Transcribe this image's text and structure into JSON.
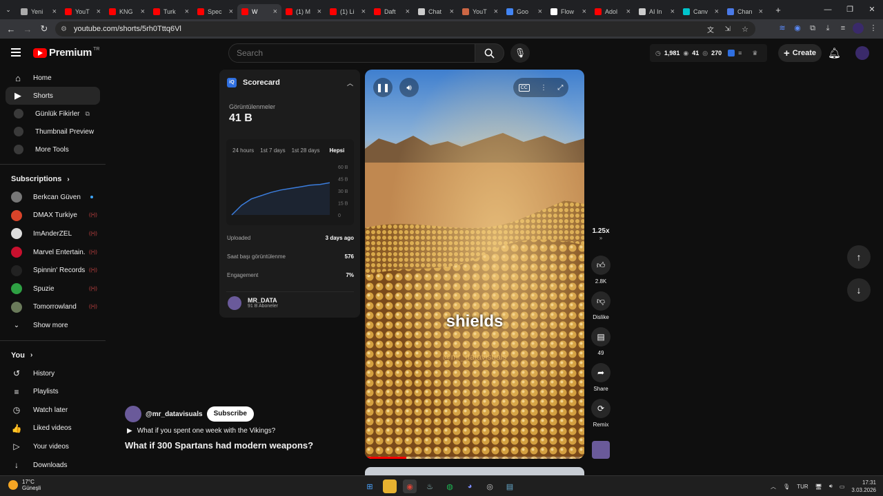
{
  "browser": {
    "tabs": [
      {
        "label": "Yeni",
        "color": "#aaaaaa"
      },
      {
        "label": "YouT",
        "color": "#ff0000"
      },
      {
        "label": "KNG",
        "color": "#ff0000"
      },
      {
        "label": "Turk",
        "color": "#ff0000"
      },
      {
        "label": "Spec",
        "color": "#ff0000"
      },
      {
        "label": "W",
        "color": "#ff0000",
        "active": true
      },
      {
        "label": "(1) M",
        "color": "#ff0000"
      },
      {
        "label": "(1) Li",
        "color": "#ff0000"
      },
      {
        "label": "Daft",
        "color": "#ff0000"
      },
      {
        "label": "Chat",
        "color": "#cccccc"
      },
      {
        "label": "YouT",
        "color": "#cc6644"
      },
      {
        "label": "Goo",
        "color": "#4285f4"
      },
      {
        "label": "Flow",
        "color": "#ffffff"
      },
      {
        "label": "Adol",
        "color": "#ff0000"
      },
      {
        "label": "AI In",
        "color": "#cccccc"
      },
      {
        "label": "Canv",
        "color": "#00c4cc"
      },
      {
        "label": "Chan",
        "color": "#4a7ae8"
      }
    ],
    "url": "youtube.com/shorts/5rh0Tttq6Vl"
  },
  "header": {
    "logo_text": "Premium",
    "country": "TR",
    "search_placeholder": "Search",
    "stats": {
      "views": "1,981",
      "eye": "41",
      "watch": "270"
    },
    "create_label": "Create"
  },
  "sidebar": {
    "main": [
      {
        "label": "Home",
        "icon": "⌂"
      },
      {
        "label": "Shorts",
        "icon": "▶",
        "active": true
      }
    ],
    "tools": [
      {
        "label": "Günlük Fikirler",
        "ext": true
      },
      {
        "label": "Thumbnail Preview"
      },
      {
        "label": "More Tools"
      }
    ],
    "subscriptions_title": "Subscriptions",
    "subscriptions": [
      {
        "name": "Berkcan Güven",
        "color": "#777777",
        "badge": "dot"
      },
      {
        "name": "DMAX Turkiye",
        "color": "#d9442a",
        "badge": "live"
      },
      {
        "name": "ImAnderZEL",
        "color": "#dddddd",
        "badge": "live"
      },
      {
        "name": "Marvel Entertain...",
        "color": "#c8102e",
        "badge": "live"
      },
      {
        "name": "Spinnin' Records",
        "color": "#222222",
        "badge": "live"
      },
      {
        "name": "Spuzie",
        "color": "#2ea043",
        "badge": "live"
      },
      {
        "name": "Tomorrowland",
        "color": "#6a7a5a",
        "badge": "live"
      }
    ],
    "show_more": "Show more",
    "you_title": "You",
    "you": [
      {
        "label": "History",
        "icon": "↺"
      },
      {
        "label": "Playlists",
        "icon": "≡"
      },
      {
        "label": "Watch later",
        "icon": "◷"
      },
      {
        "label": "Liked videos",
        "icon": "👍"
      },
      {
        "label": "Your videos",
        "icon": "▷"
      },
      {
        "label": "Downloads",
        "icon": "↓"
      }
    ]
  },
  "scorecard": {
    "title": "Scorecard",
    "views_label": "Görüntülenmeler",
    "views_value": "41 B",
    "ranges": [
      "24 hours",
      "1st 7 days",
      "1st 28 days",
      "Hepsi"
    ],
    "y_ticks": [
      "60 B",
      "45 B",
      "30 B",
      "15 B",
      "0"
    ],
    "rows": [
      {
        "label": "Uploaded",
        "value": "3 days ago"
      },
      {
        "label": "Saat başı görüntülenme",
        "value": "576"
      },
      {
        "label": "Engagement",
        "value": "7%"
      }
    ],
    "channel": "MR_DATA",
    "subscribers": "91 B Aboneler"
  },
  "chart_data": {
    "type": "line",
    "x": [
      0,
      1,
      2,
      3,
      4,
      5,
      6,
      7,
      8,
      9,
      10
    ],
    "series": [
      {
        "values": [
          0,
          12,
          20,
          24,
          28,
          31,
          33,
          35,
          37,
          38,
          40
        ]
      }
    ],
    "ylim": [
      0,
      60
    ]
  },
  "video": {
    "caption": "shields",
    "watermark": "@mr_datavisuals",
    "progress": 0.19
  },
  "actions": {
    "speed": "1.25x",
    "like_count": "2.8K",
    "dislike": "Dislike",
    "comments": "49",
    "share": "Share",
    "remix": "Remix"
  },
  "meta": {
    "channel": "@mr_datavisuals",
    "subscribe": "Subscribe",
    "playlist": "What if you spent one week with the Vikings?",
    "title": "What if 300 Spartans had modern weapons?"
  },
  "taskbar": {
    "temp": "17°C",
    "weather": "Güneşli",
    "lang": "TUR",
    "time": "17:31",
    "date": "3.03.2026"
  }
}
